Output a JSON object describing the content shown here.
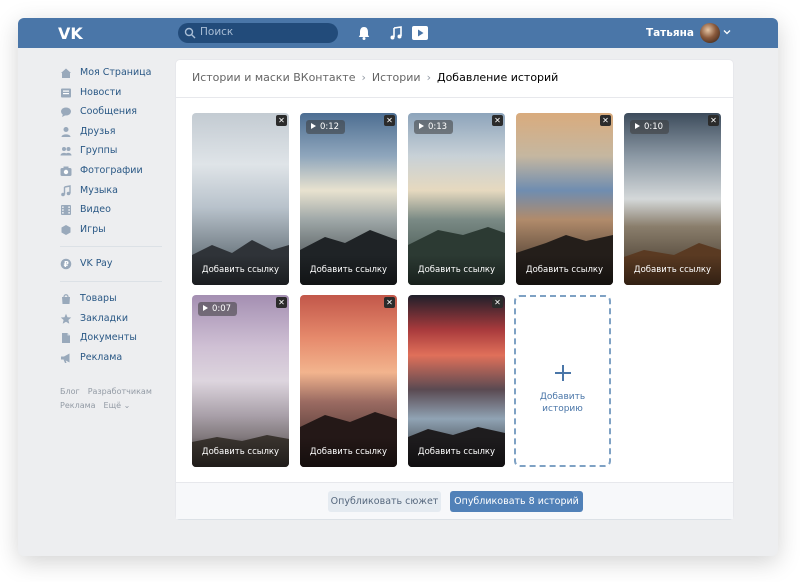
{
  "colors": {
    "brand": "#4a76a8",
    "link": "#2a5885",
    "primary_button": "#5181b8",
    "dashed_border": "#7ea1c4"
  },
  "header": {
    "logo_icon": "vk-logo",
    "search_placeholder": "Поиск",
    "icons": [
      "bell-icon",
      "music-icon",
      "play-icon"
    ],
    "user_name": "Татьяна"
  },
  "sidebar": {
    "main": [
      {
        "label": "Моя Страница",
        "icon": "home-icon"
      },
      {
        "label": "Новости",
        "icon": "news-icon"
      },
      {
        "label": "Сообщения",
        "icon": "messages-icon"
      },
      {
        "label": "Друзья",
        "icon": "friends-icon"
      },
      {
        "label": "Группы",
        "icon": "groups-icon"
      },
      {
        "label": "Фотографии",
        "icon": "camera-icon"
      },
      {
        "label": "Музыка",
        "icon": "music-icon"
      },
      {
        "label": "Видео",
        "icon": "video-icon"
      },
      {
        "label": "Игры",
        "icon": "games-icon"
      }
    ],
    "pay": {
      "label": "VK Pay",
      "icon": "vkpay-icon"
    },
    "extra": [
      {
        "label": "Товары",
        "icon": "goods-icon"
      },
      {
        "label": "Закладки",
        "icon": "star-icon"
      },
      {
        "label": "Документы",
        "icon": "document-icon"
      },
      {
        "label": "Реклама",
        "icon": "ads-icon"
      }
    ],
    "footer": {
      "blog": "Блог",
      "developers": "Разработчикам",
      "ads": "Реклама",
      "more": "Ещё ⌄"
    }
  },
  "breadcrumb": [
    "Истории и маски ВКонтакте",
    "Истории",
    "Добавление историй"
  ],
  "stories": [
    {
      "duration": "",
      "link_label": "Добавить ссылку"
    },
    {
      "duration": "0:12",
      "link_label": "Добавить ссылку"
    },
    {
      "duration": "0:13",
      "link_label": "Добавить ссылку"
    },
    {
      "duration": "",
      "link_label": "Добавить ссылку"
    },
    {
      "duration": "0:10",
      "link_label": "Добавить ссылку"
    },
    {
      "duration": "0:07",
      "link_label": "Добавить ссылку"
    },
    {
      "duration": "",
      "link_label": "Добавить ссылку"
    },
    {
      "duration": "",
      "link_label": "Добавить ссылку"
    }
  ],
  "close_glyph": "✕",
  "add_story": {
    "line1": "Добавить",
    "line2": "историю"
  },
  "actions": {
    "publish_plot": "Опубликовать сюжет",
    "publish_all": "Опубликовать 8 историй"
  }
}
